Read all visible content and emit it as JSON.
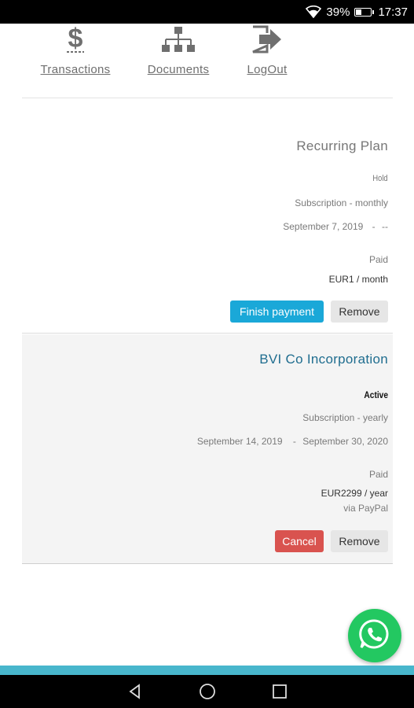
{
  "status_bar": {
    "battery_pct": "39%",
    "battery_level": 0.39,
    "time": "17:37"
  },
  "nav": {
    "items": [
      {
        "label": "Transactions",
        "icon": "dollar-icon"
      },
      {
        "label": "Documents",
        "icon": "sitemap-icon"
      },
      {
        "label": "LogOut",
        "icon": "logout-icon"
      }
    ]
  },
  "subscriptions": [
    {
      "title": "Recurring Plan",
      "status": "Hold",
      "type": "Subscription - monthly",
      "start": "September 7, 2019",
      "end_sep": "-",
      "end": "--",
      "payment_status": "Paid",
      "price": "EUR1 / month",
      "method": "",
      "primary_action": "Finish payment",
      "remove_label": "Remove"
    },
    {
      "title": "BVI Co Incorporation",
      "status": "Active",
      "type": "Subscription - yearly",
      "start": "September 14, 2019",
      "end_sep": "-",
      "end": "September 30, 2020",
      "payment_status": "Paid",
      "price": "EUR2299 / year",
      "method": "via PayPal",
      "primary_action": "Cancel",
      "remove_label": "Remove"
    }
  ],
  "colors": {
    "primary": "#1aa8d8",
    "danger": "#d9534f",
    "whatsapp": "#23c861",
    "title_link": "#1f6d8f",
    "footer_band": "#48b6cc"
  },
  "floating": {
    "icon": "whatsapp-icon"
  },
  "system_nav": {
    "icons": [
      "back-icon",
      "home-icon",
      "recents-icon"
    ]
  }
}
